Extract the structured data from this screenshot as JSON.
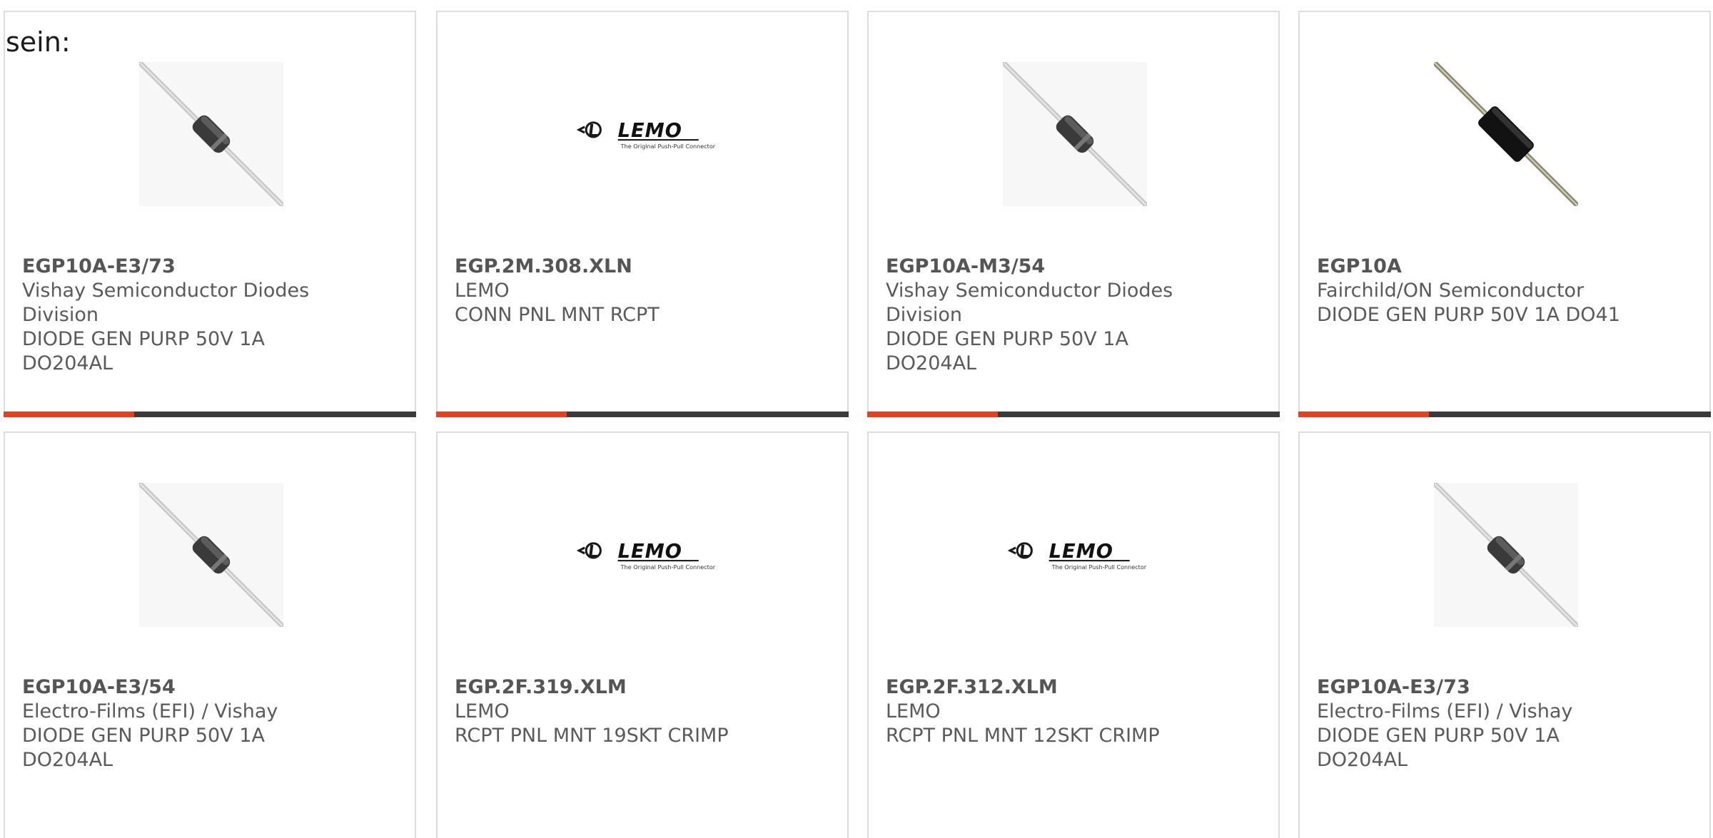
{
  "intro_text": "sein:",
  "brand_colors": {
    "accent": "#e8401d",
    "bar": "#3b3b3b",
    "border": "#dedede",
    "text": "#5a5a5a"
  },
  "products": [
    {
      "part_number": "EGP10A-E3/73",
      "manufacturer": "Vishay Semiconductor Diodes Division",
      "description": "DIODE GEN PURP 50V 1A DO204AL",
      "image": "diode-photo"
    },
    {
      "part_number": "EGP.2M.308.XLN",
      "manufacturer": "LEMO",
      "description": "CONN PNL MNT RCPT",
      "image": "lemo-logo"
    },
    {
      "part_number": "EGP10A-M3/54",
      "manufacturer": "Vishay Semiconductor Diodes Division",
      "description": "DIODE GEN PURP 50V 1A DO204AL",
      "image": "diode-photo"
    },
    {
      "part_number": "EGP10A",
      "manufacturer": "Fairchild/ON Semiconductor",
      "description": "DIODE GEN PURP 50V 1A DO41",
      "image": "diode-photo-black"
    },
    {
      "part_number": "EGP10A-E3/54",
      "manufacturer": "Electro-Films (EFI) / Vishay",
      "description": "DIODE GEN PURP 50V 1A DO204AL",
      "image": "diode-photo"
    },
    {
      "part_number": "EGP.2F.319.XLM",
      "manufacturer": "LEMO",
      "description": "RCPT PNL MNT 19SKT CRIMP",
      "image": "lemo-logo"
    },
    {
      "part_number": "EGP.2F.312.XLM",
      "manufacturer": "LEMO",
      "description": "RCPT PNL MNT 12SKT CRIMP",
      "image": "lemo-logo"
    },
    {
      "part_number": "EGP10A-E3/73",
      "manufacturer": "Electro-Films (EFI) / Vishay",
      "description": "DIODE GEN PURP 50V 1A DO204AL",
      "image": "diode-photo"
    }
  ],
  "lemo_logo": {
    "wordmark": "LEMO",
    "tagline": "The Original Push-Pull Connector"
  }
}
